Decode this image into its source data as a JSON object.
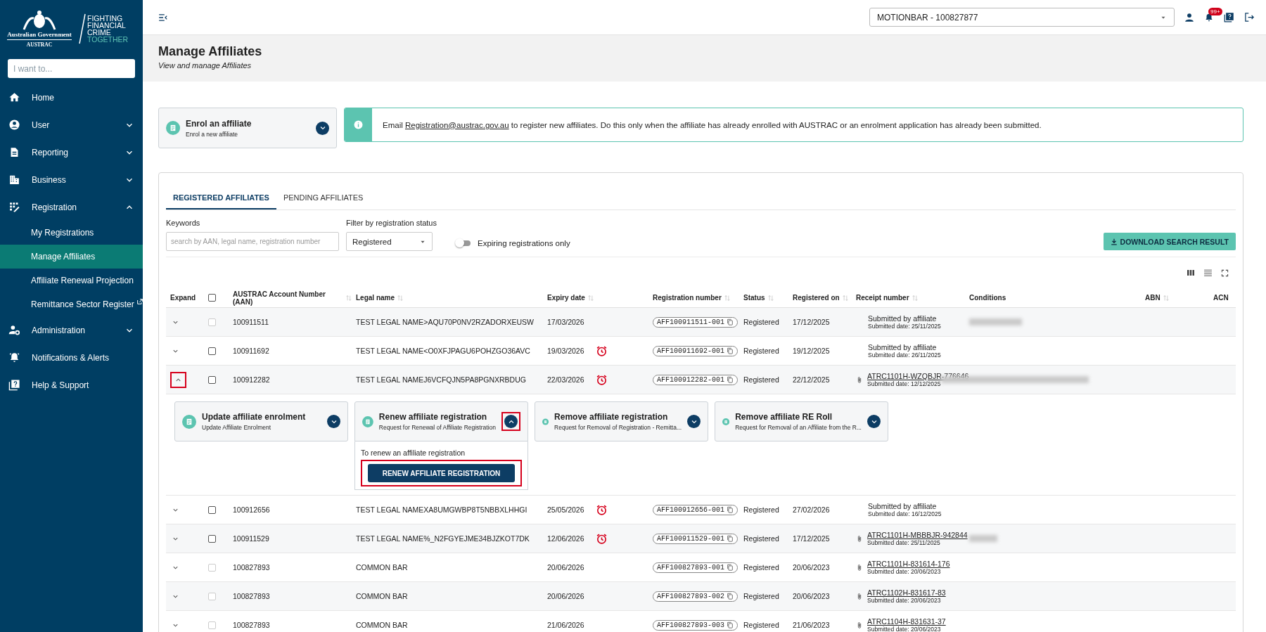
{
  "sidebar": {
    "logo": {
      "government": "Australian Government",
      "agency": "AUSTRAC",
      "slogan": [
        "FIGHTING",
        "FINANCIAL",
        "CRIME"
      ],
      "slogan_accent": "TOGETHER"
    },
    "search": {
      "placeholder": "I want to..."
    },
    "items": [
      {
        "label": "Home",
        "kind": "item",
        "selected": false
      },
      {
        "label": "User",
        "kind": "group",
        "expanded": false,
        "selected": false
      },
      {
        "label": "Reporting",
        "kind": "group",
        "expanded": false,
        "selected": false
      },
      {
        "label": "Business",
        "kind": "group",
        "expanded": false,
        "selected": false
      },
      {
        "label": "Registration",
        "kind": "group",
        "expanded": true,
        "selected": false,
        "children": [
          {
            "label": "My Registrations",
            "selected": false,
            "external": false
          },
          {
            "label": "Manage Affiliates",
            "selected": true,
            "external": false
          },
          {
            "label": "Affiliate Renewal Projection",
            "selected": false,
            "external": false
          },
          {
            "label": "Remittance Sector Register",
            "selected": false,
            "external": true
          }
        ]
      },
      {
        "label": "Administration",
        "kind": "group",
        "expanded": false,
        "selected": false
      },
      {
        "label": "Notifications & Alerts",
        "kind": "item",
        "selected": false
      },
      {
        "label": "Help & Support",
        "kind": "item",
        "selected": false
      }
    ]
  },
  "topbar": {
    "entity_select": {
      "value": "MOTIONBAR - 100827877"
    },
    "notifications_badge": "99+"
  },
  "header": {
    "title": "Manage Affiliates",
    "subtitle": "View and manage Affiliates"
  },
  "enrol_card": {
    "title": "Enrol an affiliate",
    "subtitle": "Enrol a new affiliate",
    "expanded": false
  },
  "info_banner": {
    "text_before": "Email ",
    "link": "Registration@austrac.gov.au",
    "text_after": " to register new affiliates. Do this only when the affiliate has already enrolled with AUSTRAC or an enrolment application has already been submitted."
  },
  "tabs": [
    {
      "label": "REGISTERED AFFILIATES",
      "selected": true
    },
    {
      "label": "PENDING AFFILIATES",
      "selected": false
    }
  ],
  "filters": {
    "keywords": {
      "label": "Keywords",
      "placeholder": "search by AAN, legal name, registration number"
    },
    "status": {
      "label": "Filter by registration status",
      "value": "Registered"
    },
    "expiring_toggle": {
      "label": "Expiring registrations only",
      "on": false
    },
    "download_button": "DOWNLOAD SEARCH RESULT"
  },
  "table": {
    "select_all": {
      "checked": false
    },
    "columns": [
      {
        "label": "Expand",
        "sortable": false
      },
      {
        "label": "AUSTRAC Account Number (AAN)",
        "sortable": true
      },
      {
        "label": "Legal name",
        "sortable": true
      },
      {
        "label": "Expiry date",
        "sortable": true
      },
      {
        "label": "Registration number",
        "sortable": true
      },
      {
        "label": "Status",
        "sortable": true
      },
      {
        "label": "Registered on",
        "sortable": true
      },
      {
        "label": "Receipt number",
        "sortable": true
      },
      {
        "label": "Conditions",
        "sortable": false
      },
      {
        "label": "ABN",
        "sortable": true
      },
      {
        "label": "ACN",
        "sortable": false
      }
    ],
    "rows": [
      {
        "expanded": false,
        "highlighted": false,
        "checked": false,
        "disabled": true,
        "aan": "100911511",
        "legal_name": "TEST LEGAL NAME>AQU70P0NV2RZADORXEUSW",
        "expiry": "17/03/2026",
        "expiring": false,
        "registration_number": "AFF100911511-001",
        "status": "Registered",
        "registered_on": "17/12/2025",
        "receipt": {
          "kind": "submitted",
          "text": "Submitted by affiliate",
          "date": "Submitted date: 25/11/2025"
        },
        "conditions_redacted": true
      },
      {
        "expanded": false,
        "highlighted": false,
        "checked": false,
        "disabled": false,
        "aan": "100911692",
        "legal_name": "TEST LEGAL NAME<O0XFJPAGU6POHZGO36AVC",
        "expiry": "19/03/2026",
        "expiring": true,
        "registration_number": "AFF100911692-001",
        "status": "Registered",
        "registered_on": "19/12/2025",
        "receipt": {
          "kind": "submitted",
          "text": "Submitted by affiliate",
          "date": "Submitted date: 26/11/2025"
        },
        "conditions_redacted": false
      },
      {
        "expanded": true,
        "highlighted": true,
        "checked": false,
        "disabled": false,
        "aan": "100912282",
        "legal_name": "TEST LEGAL NAMEJ6VCFQJN5PA8PGNXRBDUG",
        "expiry": "22/03/2026",
        "expiring": true,
        "registration_number": "AFF100912282-001",
        "status": "Registered",
        "registered_on": "22/12/2025",
        "receipt": {
          "kind": "link",
          "text": "ATRC1101H-WZQBJR-776646",
          "date": "Submitted date: 12/12/2025"
        },
        "conditions_redacted": true,
        "actions": [
          {
            "title": "Update affiliate enrolment",
            "subtitle": "Update Affiliate Enrolment",
            "expanded": false,
            "highlighted": false
          },
          {
            "title": "Renew affiliate registration",
            "subtitle": "Request for Renewal of Affiliate Registration",
            "expanded": true,
            "highlighted": true,
            "body": "To renew an affiliate registration",
            "button": "RENEW AFFILIATE REGISTRATION",
            "button_highlighted": true
          },
          {
            "title": "Remove affiliate registration",
            "subtitle": "Request for Removal of Registration - Remitta...",
            "expanded": false,
            "highlighted": false
          },
          {
            "title": "Remove affiliate RE Roll",
            "subtitle": "Request for Removal of an Affiliate from the R...",
            "expanded": false,
            "highlighted": false
          }
        ]
      },
      {
        "expanded": false,
        "highlighted": false,
        "checked": false,
        "disabled": false,
        "aan": "100912656",
        "legal_name": "TEST LEGAL NAMEXA8UMGWBP8T5NBBXLHHGI",
        "expiry": "25/05/2026",
        "expiring": true,
        "registration_number": "AFF100912656-001",
        "status": "Registered",
        "registered_on": "27/02/2026",
        "receipt": {
          "kind": "submitted",
          "text": "Submitted by affiliate",
          "date": "Submitted date: 16/12/2025"
        },
        "conditions_redacted": false
      },
      {
        "expanded": false,
        "highlighted": false,
        "checked": false,
        "disabled": false,
        "aan": "100911529",
        "legal_name": "TEST LEGAL NAME%_N2FGYEJME34BJZKOT7DK",
        "expiry": "12/06/2026",
        "expiring": true,
        "registration_number": "AFF100911529-001",
        "status": "Registered",
        "registered_on": "17/12/2025",
        "receipt": {
          "kind": "link",
          "text": "ATRC1101H-MBBBJR-942844",
          "date": "Submitted date: 25/11/2025"
        },
        "conditions_redacted": true
      },
      {
        "expanded": false,
        "highlighted": false,
        "checked": false,
        "disabled": true,
        "aan": "100827893",
        "legal_name": "COMMON BAR",
        "expiry": "20/06/2026",
        "expiring": false,
        "registration_number": "AFF100827893-001",
        "status": "Registered",
        "registered_on": "20/06/2023",
        "receipt": {
          "kind": "link",
          "text": "ATRC1101H-831614-176",
          "date": "Submitted date: 20/06/2023"
        },
        "conditions_redacted": false
      },
      {
        "expanded": false,
        "highlighted": false,
        "checked": false,
        "disabled": true,
        "aan": "100827893",
        "legal_name": "COMMON BAR",
        "expiry": "20/06/2026",
        "expiring": false,
        "registration_number": "AFF100827893-002",
        "status": "Registered",
        "registered_on": "20/06/2023",
        "receipt": {
          "kind": "link",
          "text": "ATRC1102H-831617-83",
          "date": "Submitted date: 20/06/2023"
        },
        "conditions_redacted": false
      },
      {
        "expanded": false,
        "highlighted": false,
        "checked": false,
        "disabled": true,
        "aan": "100827893",
        "legal_name": "COMMON BAR",
        "expiry": "21/06/2026",
        "expiring": false,
        "registration_number": "AFF100827893-003",
        "status": "Registered",
        "registered_on": "21/06/2023",
        "receipt": {
          "kind": "link",
          "text": "ATRC1104H-831631-37",
          "date": "Submitted date: 20/06/2023"
        },
        "conditions_redacted": false
      }
    ]
  }
}
